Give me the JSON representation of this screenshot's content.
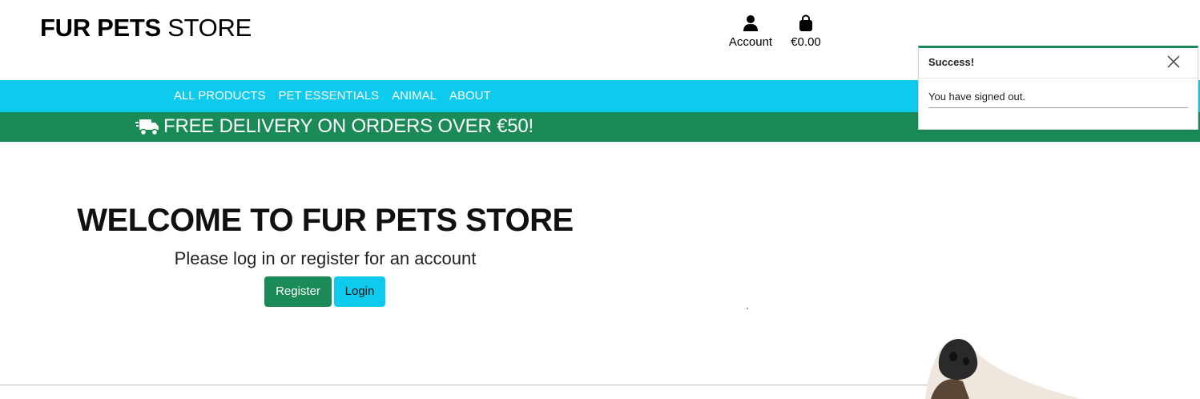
{
  "header": {
    "logo_bold": "FUR PETS",
    "logo_light": "STORE",
    "account_label": "Account",
    "bag_total": "€0.00",
    "icons": {
      "account": "user-icon",
      "bag": "shopping-bag-icon"
    }
  },
  "nav": {
    "items": [
      {
        "label": "ALL PRODUCTS"
      },
      {
        "label": "PET ESSENTIALS"
      },
      {
        "label": "ANIMAL"
      },
      {
        "label": "ABOUT"
      }
    ]
  },
  "promo": {
    "icon": "truck-fast-icon",
    "text": "FREE DELIVERY ON ORDERS OVER €50!"
  },
  "hero": {
    "title": "WELCOME TO FUR PETS STORE",
    "subtitle": "Please log in or register for an account",
    "register_label": "Register",
    "login_label": "Login"
  },
  "toast": {
    "title": "Success!",
    "message": "You have signed out.",
    "close_icon": "close-icon"
  },
  "colors": {
    "cyan": "#0ecaed",
    "green": "#1a8a57",
    "white": "#ffffff"
  }
}
